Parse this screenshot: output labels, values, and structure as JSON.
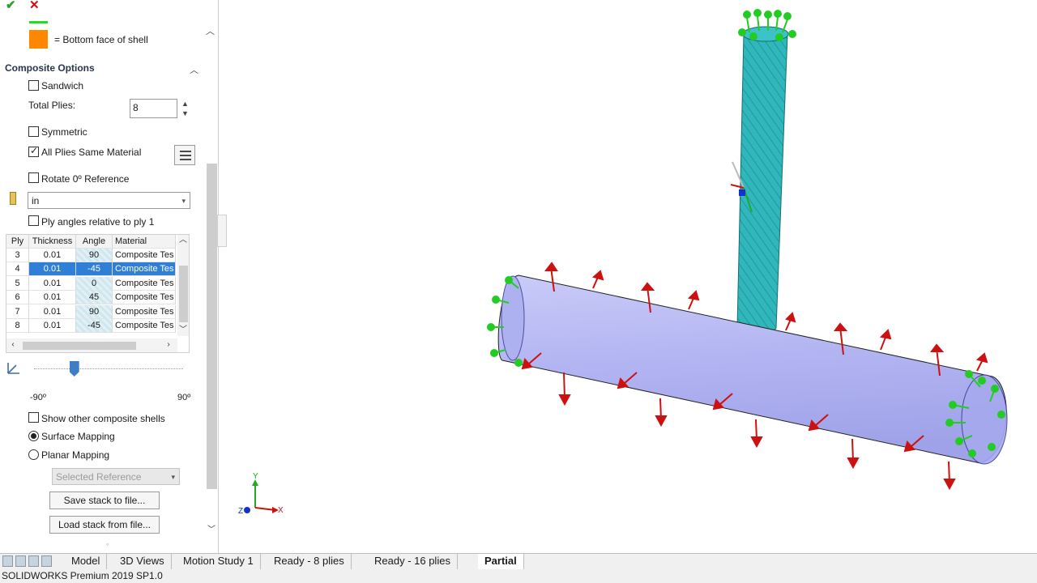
{
  "toolbar": {
    "ok_label": "✔",
    "cancel_label": "✕"
  },
  "legend": {
    "bottom_face_label": "= Bottom face of shell",
    "orange_color": "#ff8800",
    "green_color": "#22dd22"
  },
  "composite_options": {
    "title": "Composite Options",
    "sandwich_label": "Sandwich",
    "sandwich_checked": false,
    "total_plies_label": "Total Plies:",
    "total_plies_value": "8",
    "symmetric_label": "Symmetric",
    "all_plies_same_material_label": "All Plies Same Material",
    "all_plies_same_material_checked": true,
    "rotate_reference_label": "Rotate 0º Reference",
    "unit_value": "in",
    "ply_angles_relative_label": "Ply angles relative to ply 1"
  },
  "ply_table": {
    "columns": [
      "Ply",
      "Thickness",
      "Angle",
      "Material"
    ],
    "rows": [
      {
        "ply": "3",
        "thickness": "0.01",
        "angle": "90",
        "material": "Composite Tes"
      },
      {
        "ply": "4",
        "thickness": "0.01",
        "angle": "-45",
        "material": "Composite Tes"
      },
      {
        "ply": "5",
        "thickness": "0.01",
        "angle": "0",
        "material": "Composite Tes"
      },
      {
        "ply": "6",
        "thickness": "0.01",
        "angle": "45",
        "material": "Composite Tes"
      },
      {
        "ply": "7",
        "thickness": "0.01",
        "angle": "90",
        "material": "Composite Tes"
      },
      {
        "ply": "8",
        "thickness": "0.01",
        "angle": "-45",
        "material": "Composite Tes"
      }
    ],
    "selected_ply": "4"
  },
  "angle_slider": {
    "min_label": "-90º",
    "max_label": "90º",
    "value_fraction": 0.27
  },
  "options": {
    "show_other_shells_label": "Show other composite shells",
    "surface_mapping_label": "Surface Mapping",
    "surface_mapping_selected": true,
    "planar_mapping_label": "Planar Mapping",
    "selected_reference_placeholder": "Selected Reference",
    "save_stack_label": "Save stack to file...",
    "load_stack_label": "Load stack from file..."
  },
  "tabs": [
    {
      "label": "Model",
      "active": false
    },
    {
      "label": "3D Views",
      "active": false
    },
    {
      "label": "Motion Study 1",
      "active": false
    },
    {
      "label": "Ready - 8 plies",
      "active": false
    },
    {
      "label": "Ready - 16 plies",
      "active": false
    },
    {
      "label": "Partial",
      "active": true
    }
  ],
  "status_bar": {
    "text": "SOLIDWORKS Premium 2019 SP1.0"
  },
  "triad": {
    "x_label": "X",
    "y_label": "Y",
    "z_label": "Z"
  },
  "colors": {
    "tube": "#b4b6f4",
    "post": "#2ab3b8",
    "load_arrow": "#cc1111",
    "fixture": "#22cc22",
    "selection": "#2f7fd6"
  }
}
